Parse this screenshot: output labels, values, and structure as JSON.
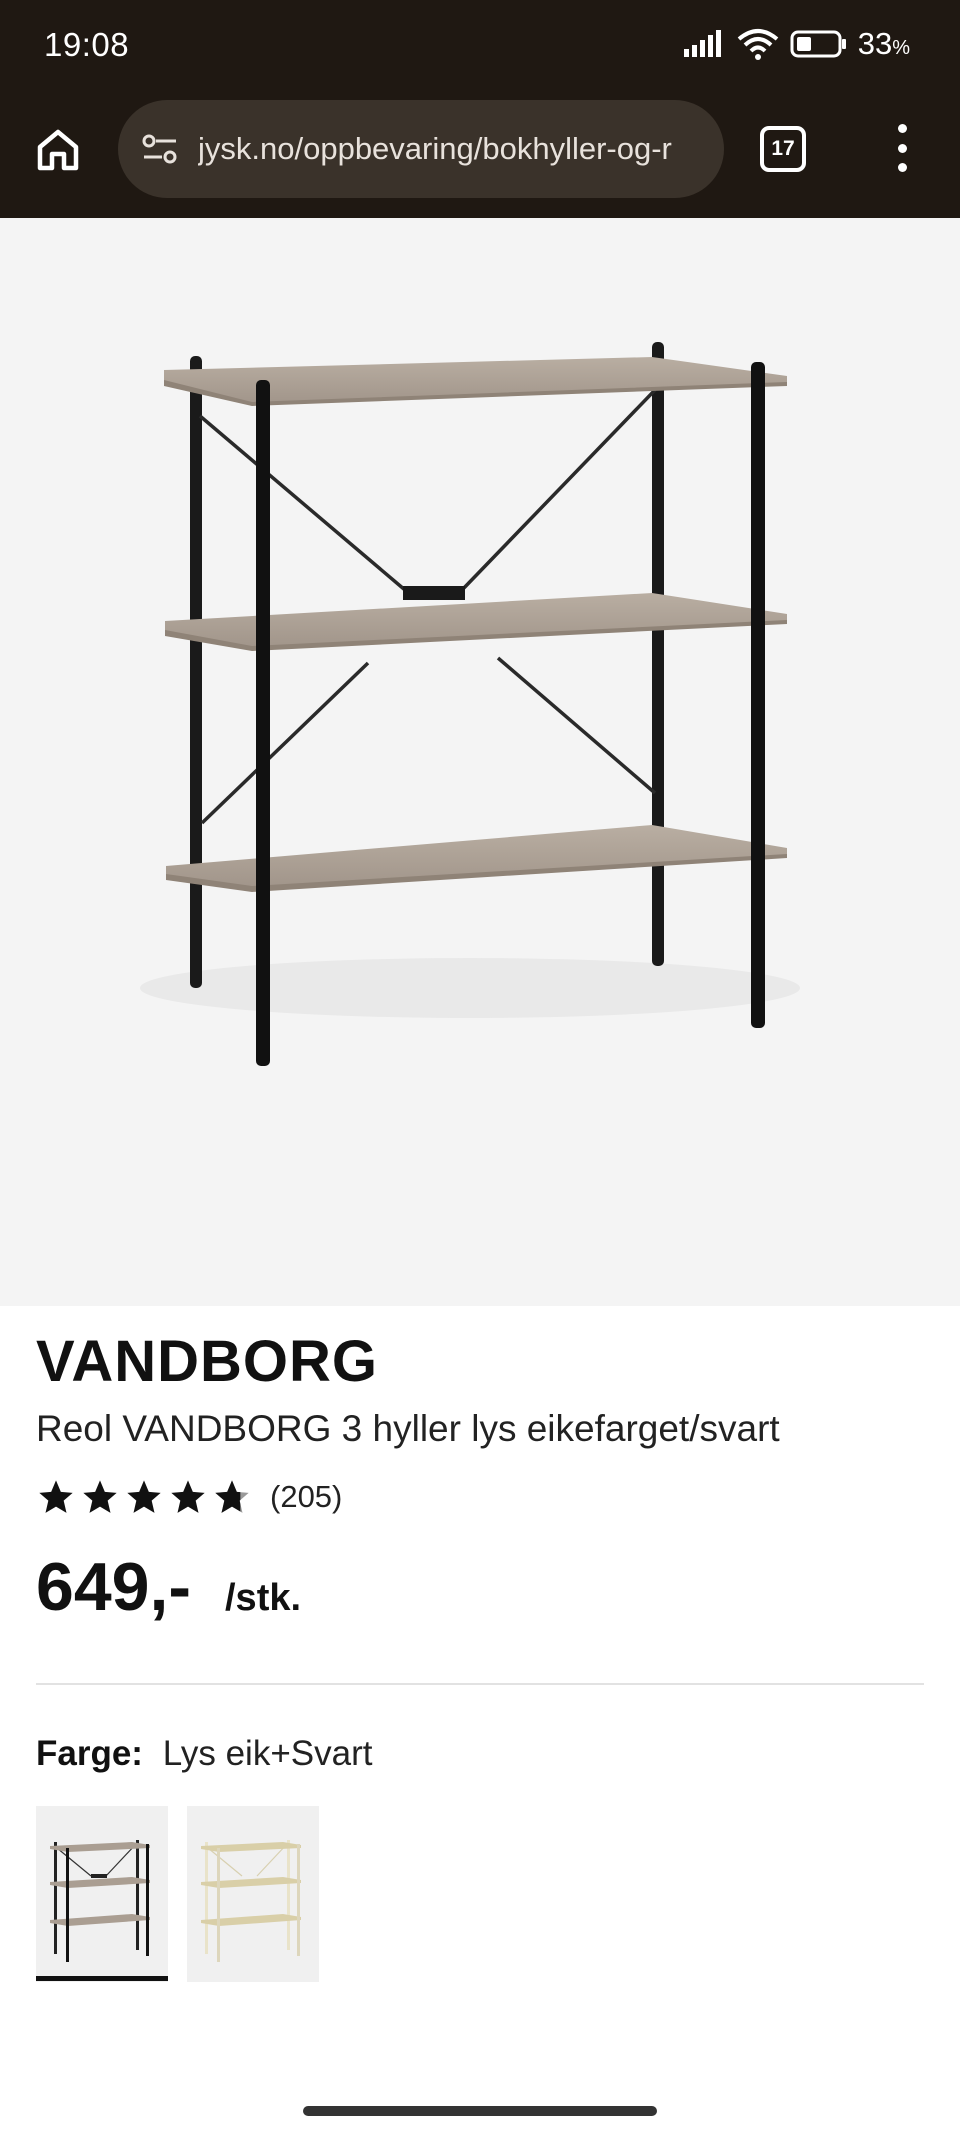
{
  "status_bar": {
    "time": "19:08",
    "battery_percent": "33",
    "battery_unit": "%"
  },
  "browser": {
    "url": "jysk.no/oppbevaring/bokhyller-og-r",
    "tab_count": "17",
    "icons": [
      "home-icon",
      "site-settings-icon",
      "tabs-icon",
      "more-icon"
    ]
  },
  "product": {
    "brand": "VANDBORG",
    "name": "Reol VANDBORG 3 hyller lys eikefarget/svart",
    "rating": 4.7,
    "rating_max": 5,
    "review_count": "(205)",
    "price": "649,-",
    "unit": "/stk.",
    "color_label": "Farge:",
    "color_value": "Lys eik+Svart",
    "swatches": [
      {
        "name": "Lys eik+Svart",
        "selected": true
      },
      {
        "name": "Lys eik+Hvit",
        "selected": false
      }
    ]
  },
  "colors": {
    "chrome_bg": "#1f1812",
    "urlbar_bg": "#3a322a",
    "image_bg": "#f4f4f4",
    "star": "#111111"
  }
}
